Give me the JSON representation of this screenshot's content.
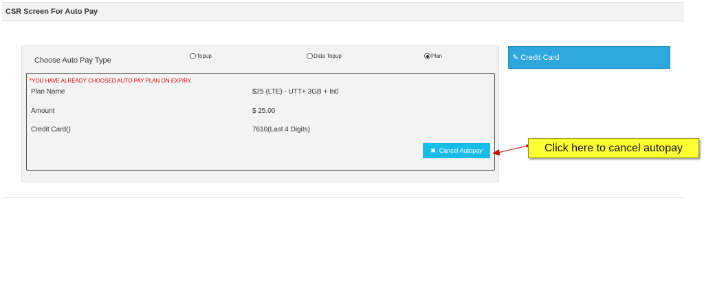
{
  "header": {
    "title": "CSR Screen For Auto Pay"
  },
  "auto_pay_type": {
    "label": "Choose Auto Pay Type",
    "options": [
      {
        "label": "Topup",
        "selected": false
      },
      {
        "label": "Data Topup",
        "selected": false
      },
      {
        "label": "Plan",
        "selected": true
      }
    ]
  },
  "plan_details": {
    "warning": "*YOU HAVE ALREADY CHOOSED AUTO PAY PLAN ON EXPIRY.",
    "rows": [
      {
        "label": "Plan Name",
        "value": "$25 (LTE) - UTT+ 3GB + Intl"
      },
      {
        "label": "Amount",
        "value": "$ 25.00"
      },
      {
        "label": "Credit Card()",
        "value": "7610(Last 4 Digits)"
      }
    ],
    "cancel_button": {
      "icon": "x-icon",
      "label": "Cancel Autopay"
    }
  },
  "credit_card_panel": {
    "icon": "edit-icon",
    "label": "Credit Card"
  },
  "annotation": {
    "text": "Click here to cancel autopay"
  },
  "colors": {
    "accent": "#18bde7",
    "panel_blue": "#2ea7dd",
    "warning": "#e00000",
    "callout": "#ffff33",
    "arrow": "#cc0000"
  }
}
